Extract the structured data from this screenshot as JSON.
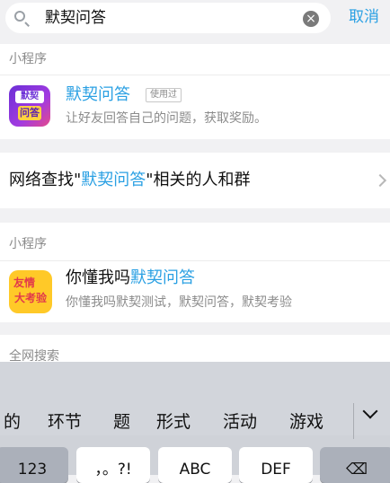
{
  "search": {
    "query": "默契问答",
    "clear_icon": "×",
    "cancel_label": "取消"
  },
  "section1": {
    "header": "小程序",
    "app": {
      "icon_top": "默契",
      "icon_bottom": "问答",
      "name": "默契问答",
      "badge": "使用过",
      "description": "让好友回答自己的问题，获取奖励。"
    }
  },
  "network_search": {
    "prefix": "网络查找\"",
    "keyword": "默契问答",
    "suffix": "\"相关的人和群"
  },
  "section3": {
    "header": "小程序",
    "app": {
      "icon_line1": "友情",
      "icon_line2": "大考验",
      "name_prefix": "你懂我吗",
      "name_highlight": "默契问答",
      "description": "你懂我吗默契测试，默契问答，默契考验"
    }
  },
  "section4": {
    "header": "全网搜索"
  },
  "keyboard": {
    "candidates": [
      "的",
      "环节",
      "题",
      "形式",
      "活动",
      "游戏"
    ],
    "keys": [
      "123",
      "，。?!",
      "ABC",
      "DEF",
      "⌫"
    ]
  }
}
